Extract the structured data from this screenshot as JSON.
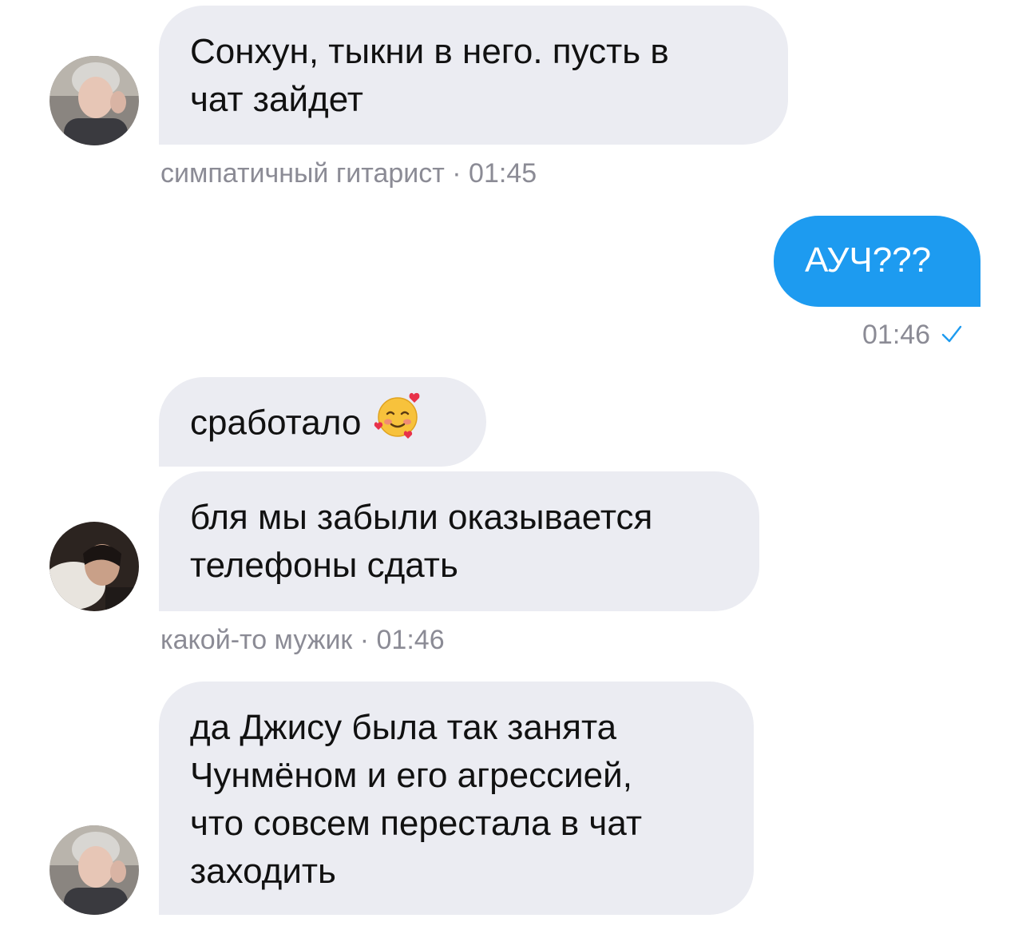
{
  "messages": [
    {
      "text_lines": [
        "Сонхун, тыкни в него. пусть в",
        "чат зайдет"
      ],
      "meta": "симпатичный гитарист · 01:45"
    },
    {
      "text": "АУЧ???",
      "time": "01:46"
    },
    {
      "text": "сработало"
    },
    {
      "text_lines": [
        "бля мы забыли оказывается",
        "телефоны сдать"
      ],
      "meta": "какой-то мужик · 01:46"
    },
    {
      "text_lines": [
        "да Джису была так занята",
        "Чунмёном и его агрессией,",
        "что совсем перестала в чат",
        "заходить"
      ]
    }
  ],
  "icons": {
    "emoji": "smiling-face-with-hearts-icon",
    "read_status": "checkmark-icon"
  },
  "colors": {
    "incoming_bubble": "#ebecf2",
    "outgoing_bubble": "#1d9bf0",
    "meta_text": "#8b8b95",
    "check": "#1d9bf0"
  }
}
